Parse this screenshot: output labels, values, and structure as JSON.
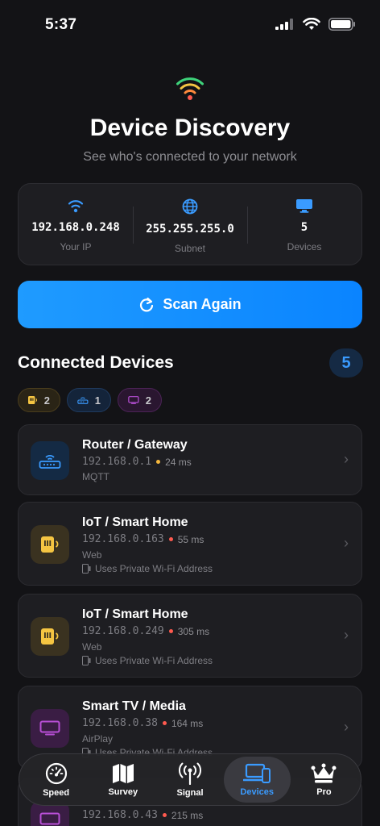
{
  "status": {
    "time": "5:37"
  },
  "header": {
    "title": "Device Discovery",
    "subtitle": "See who's connected to your network"
  },
  "network": {
    "ip": {
      "value": "192.168.0.248",
      "label": "Your IP",
      "icon": "wifi-icon"
    },
    "subnet": {
      "value": "255.255.255.0",
      "label": "Subnet",
      "icon": "globe-icon"
    },
    "devices": {
      "value": "5",
      "label": "Devices",
      "icon": "monitor-icon"
    }
  },
  "scan_button": {
    "label": "Scan Again",
    "icon": "refresh-icon"
  },
  "section": {
    "title": "Connected Devices",
    "count": "5"
  },
  "chips": [
    {
      "icon": "iot-icon",
      "count": "2"
    },
    {
      "icon": "router-icon",
      "count": "1"
    },
    {
      "icon": "tv-icon",
      "count": "2"
    }
  ],
  "devices": [
    {
      "name": "Router / Gateway",
      "ip": "192.168.0.1",
      "latency": "24 ms",
      "protocol": "MQTT",
      "private": ""
    },
    {
      "name": "IoT / Smart Home",
      "ip": "192.168.0.163",
      "latency": "55 ms",
      "protocol": "Web",
      "private": "Uses Private Wi-Fi Address"
    },
    {
      "name": "IoT / Smart Home",
      "ip": "192.168.0.249",
      "latency": "305 ms",
      "protocol": "Web",
      "private": "Uses Private Wi-Fi Address"
    },
    {
      "name": "Smart TV / Media",
      "ip": "192.168.0.38",
      "latency": "164 ms",
      "protocol": "AirPlay",
      "private": "Uses Private Wi-Fi Address"
    },
    {
      "name": "",
      "ip": "192.168.0.43",
      "latency": "215 ms",
      "protocol": "",
      "private": ""
    }
  ],
  "colors": {
    "accent": "#0a84ff",
    "latency_good": "#f5b83d",
    "latency_bad": "#ff5a4f",
    "iot": "#f5c542",
    "router": "#3a9bff",
    "tv": "#b84fd6"
  },
  "tabs": [
    {
      "label": "Speed",
      "icon": "speedometer-icon",
      "active": false
    },
    {
      "label": "Survey",
      "icon": "map-icon",
      "active": false
    },
    {
      "label": "Signal",
      "icon": "antenna-icon",
      "active": false
    },
    {
      "label": "Devices",
      "icon": "devices-icon",
      "active": true
    },
    {
      "label": "Pro",
      "icon": "crown-icon",
      "active": false
    }
  ]
}
